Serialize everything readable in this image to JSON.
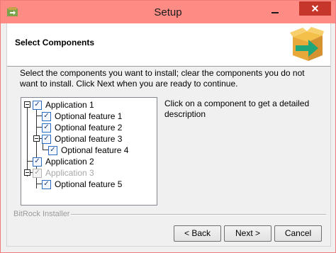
{
  "window": {
    "title": "Setup",
    "close_glyph": "✕",
    "accent_color": "#ff8c84",
    "close_color": "#c6362a"
  },
  "header": {
    "title": "Select Components",
    "logo_icon": "package-arrow-icon"
  },
  "instructions": "Select the components you want to install; clear the components you do not want to install. Click Next when you are ready to continue.",
  "tree": {
    "items": [
      {
        "label": "Application 1",
        "checked": true,
        "enabled": true
      },
      {
        "label": "Optional feature 1",
        "checked": true,
        "enabled": true
      },
      {
        "label": "Optional feature 2",
        "checked": true,
        "enabled": true
      },
      {
        "label": "Optional feature 3",
        "checked": true,
        "enabled": true
      },
      {
        "label": "Optional feature 4",
        "checked": true,
        "enabled": true
      },
      {
        "label": "Application 2",
        "checked": true,
        "enabled": true
      },
      {
        "label": "Application 3",
        "checked": true,
        "enabled": false
      },
      {
        "label": "Optional feature 5",
        "checked": true,
        "enabled": true
      }
    ],
    "check_glyph": "✓"
  },
  "description": "Click on a component to get a detailed description",
  "footer": {
    "installer_label": "BitRock Installer",
    "back_label": "< Back",
    "next_label": "Next >",
    "cancel_label": "Cancel"
  }
}
